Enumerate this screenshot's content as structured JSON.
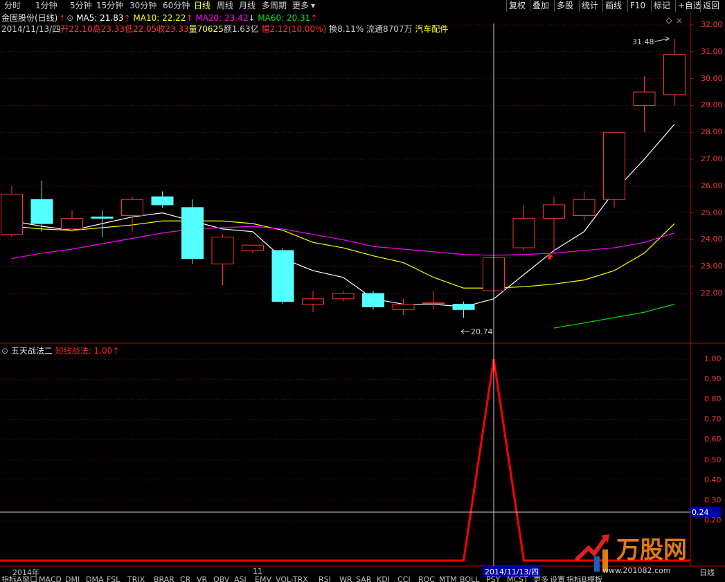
{
  "toolbar": {
    "periods": [
      "分时",
      "1分钟",
      "5分钟",
      "15分钟",
      "30分钟",
      "60分钟",
      "日线",
      "周线",
      "月线",
      "多周期",
      "更多"
    ],
    "active_period": "日线",
    "right_buttons": [
      "复权",
      "叠加",
      "多股",
      "统计",
      "画线",
      "F10",
      "标记",
      "+自选",
      "返回"
    ]
  },
  "header": {
    "stock_name": "金固股份(日线)",
    "ma5_label": "MA5: 21.83",
    "ma10_label": "MA10: 22.22",
    "ma20_label": "MA20: 23.42",
    "ma60_label": "MA60: 20.31",
    "date": "2014/11/13/四",
    "open": "开22.10",
    "high": "高23.33",
    "low": "低22.05",
    "close": "收23.33",
    "volume": "量70625",
    "amount": "额1.63亿",
    "change": "幅2.12(10.00%)",
    "turnover": "换8.11%",
    "float": "流通8707万",
    "sector": "汽车配件"
  },
  "indicator": {
    "name": "五天战法二",
    "line_label": "短线战法: 1.00"
  },
  "axis": {
    "price_ticks": [
      "32.00",
      "31.00",
      "30.00",
      "29.00",
      "28.00",
      "27.00",
      "26.00",
      "25.00",
      "24.00",
      "23.00",
      "22.00"
    ],
    "ind_ticks": [
      "1.00",
      "0.90",
      "0.80",
      "0.70",
      "0.60",
      "0.50",
      "0.40",
      "0.30",
      "0.20"
    ],
    "crosshair_value": "0.24",
    "high_label": "31.48",
    "low_label": "20.74"
  },
  "time_axis": {
    "year_label": "2014年",
    "month_label": "11",
    "cursor_date": "2014/11/13/四",
    "right_label": "日线"
  },
  "bottom_tabs": [
    "指标A",
    "窗口",
    "MACD",
    "DMI",
    "DMA",
    "FSL",
    "TRIX",
    "BRAR",
    "CR",
    "VR",
    "OBV",
    "ASI",
    "EMV",
    "VOL-TRX",
    "RSI",
    "WR",
    "SAR",
    "KDJ",
    "CCI",
    "ROC",
    "MTM",
    "BOLL",
    "PSY",
    "MCST",
    "更多",
    "设置",
    "指标B",
    "模板"
  ],
  "watermark": {
    "brand": "万股网",
    "url": "www.201082.com"
  },
  "colors": {
    "up": "#ff3232",
    "down": "#54ffff",
    "ma5": "#ffffff",
    "ma10": "#ffff00",
    "ma20": "#ff00ff",
    "ma60": "#00e600",
    "signal": "#ff0000"
  },
  "chart_data": [
    {
      "type": "candlestick",
      "title": "金固股份(日线)",
      "ylim": [
        20.3,
        32.3
      ],
      "candles": [
        {
          "o": 24.2,
          "h": 26.0,
          "l": 24.1,
          "c": 25.7
        },
        {
          "o": 25.5,
          "h": 26.2,
          "l": 24.3,
          "c": 24.6
        },
        {
          "o": 24.4,
          "h": 25.1,
          "l": 24.3,
          "c": 24.8
        },
        {
          "o": 24.85,
          "h": 25.1,
          "l": 24.1,
          "c": 24.8
        },
        {
          "o": 24.9,
          "h": 25.6,
          "l": 24.3,
          "c": 25.5
        },
        {
          "o": 25.6,
          "h": 25.8,
          "l": 25.2,
          "c": 25.3
        },
        {
          "o": 25.2,
          "h": 25.5,
          "l": 23.1,
          "c": 23.3
        },
        {
          "o": 23.1,
          "h": 24.2,
          "l": 22.3,
          "c": 24.1
        },
        {
          "o": 23.6,
          "h": 23.8,
          "l": 23.5,
          "c": 23.8
        },
        {
          "o": 23.6,
          "h": 23.7,
          "l": 21.6,
          "c": 21.7
        },
        {
          "o": 21.6,
          "h": 22.1,
          "l": 21.3,
          "c": 21.8
        },
        {
          "o": 21.8,
          "h": 22.1,
          "l": 21.7,
          "c": 22.0
        },
        {
          "o": 22.0,
          "h": 22.1,
          "l": 21.4,
          "c": 21.5
        },
        {
          "o": 21.4,
          "h": 21.8,
          "l": 21.2,
          "c": 21.6
        },
        {
          "o": 21.65,
          "h": 22.1,
          "l": 21.4,
          "c": 21.65
        },
        {
          "o": 21.6,
          "h": 21.7,
          "l": 21.1,
          "c": 21.4
        },
        {
          "o": 22.1,
          "h": 23.33,
          "l": 22.05,
          "c": 23.33
        },
        {
          "o": 23.7,
          "h": 25.3,
          "l": 23.6,
          "c": 24.8
        },
        {
          "o": 24.8,
          "h": 25.6,
          "l": 23.5,
          "c": 25.3
        },
        {
          "o": 24.9,
          "h": 25.8,
          "l": 24.7,
          "c": 25.5
        },
        {
          "o": 25.5,
          "h": 28.0,
          "l": 25.2,
          "c": 28.0
        },
        {
          "o": 29.0,
          "h": 30.1,
          "l": 28.0,
          "c": 29.5
        },
        {
          "o": 29.4,
          "h": 31.48,
          "l": 29.0,
          "c": 30.9
        }
      ],
      "ma5": [
        24.7,
        24.5,
        24.35,
        24.6,
        24.85,
        25.0,
        24.7,
        24.4,
        24.3,
        23.3,
        22.85,
        22.6,
        21.8,
        21.6,
        21.6,
        21.5,
        21.8,
        22.7,
        23.6,
        24.3,
        25.8,
        27.0,
        28.3
      ],
      "ma10": [
        24.5,
        24.4,
        24.35,
        24.45,
        24.55,
        24.7,
        24.7,
        24.7,
        24.6,
        24.35,
        23.9,
        23.7,
        23.4,
        23.15,
        22.6,
        22.2,
        22.2,
        22.25,
        22.35,
        22.5,
        22.85,
        23.5,
        24.6
      ],
      "ma20": [
        23.3,
        23.5,
        23.65,
        23.85,
        24.05,
        24.25,
        24.4,
        24.45,
        24.5,
        24.4,
        24.2,
        24.0,
        23.75,
        23.65,
        23.55,
        23.45,
        23.42,
        23.45,
        23.5,
        23.6,
        23.7,
        23.9,
        24.25
      ],
      "ma60": [
        null,
        null,
        null,
        null,
        null,
        null,
        null,
        null,
        null,
        null,
        null,
        null,
        null,
        null,
        null,
        null,
        null,
        null,
        20.71,
        20.9,
        21.1,
        21.3,
        21.6
      ],
      "high_label": "31.48",
      "low_label": "20.74",
      "cursor_index": 16
    },
    {
      "type": "line",
      "title": "五天战法二",
      "ylim": [
        0.0,
        1.05
      ],
      "series": [
        {
          "name": "短线战法",
          "values": [
            0,
            0,
            0,
            0,
            0,
            0,
            0,
            0,
            0,
            0,
            0,
            0,
            0,
            0,
            0,
            0,
            1,
            0,
            0,
            0,
            0,
            0,
            0
          ]
        }
      ]
    }
  ]
}
